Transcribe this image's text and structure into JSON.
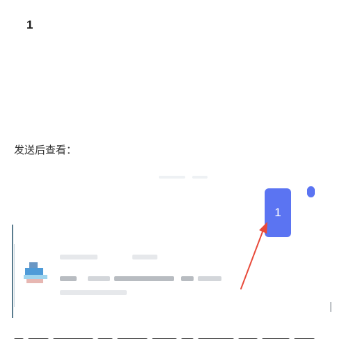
{
  "step": {
    "number": "1"
  },
  "caption": {
    "text": "发送后查看："
  },
  "chat": {
    "bubble_text": "1",
    "accent_color": "#5b74f2"
  },
  "annotation": {
    "arrow_color": "#e84a3a",
    "icon": "red-arrow-icon"
  }
}
